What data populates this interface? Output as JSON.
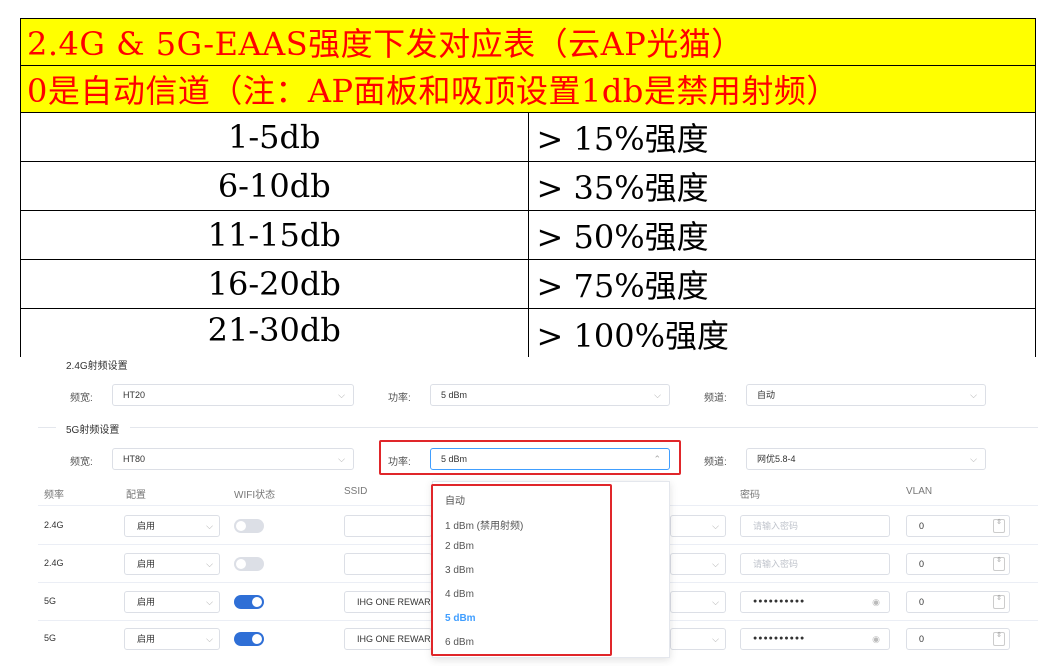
{
  "ref_table": {
    "title": "2.4G & 5G-EAAS强度下发对应表（云AP光猫）",
    "note": "0是自动信道（注：AP面板和吸顶设置1db是禁用射频）",
    "rows": [
      {
        "range": "1-5db",
        "value": "> 15%强度"
      },
      {
        "range": "6-10db",
        "value": "> 35%强度"
      },
      {
        "range": "11-15db",
        "value": "> 50%强度"
      },
      {
        "range": "16-20db",
        "value": "> 75%强度"
      },
      {
        "range": "21-30db",
        "value": "> 100%强度"
      }
    ]
  },
  "colors": {
    "highlight": "#ffff00",
    "red_text": "#ff0000",
    "accent": "#409eff",
    "toggle_on": "#2f6fd6",
    "red_box": "#e0262a"
  },
  "radio_24": {
    "section_title": "2.4G射频设置",
    "bandwidth_label": "频宽:",
    "bandwidth_value": "HT20",
    "power_label": "功率:",
    "power_value": "5 dBm",
    "channel_label": "频道:",
    "channel_value": "自动"
  },
  "radio_5": {
    "section_title": "5G射频设置",
    "bandwidth_label": "频宽:",
    "bandwidth_value": "HT80",
    "power_label": "功率:",
    "power_value": "5 dBm",
    "channel_label": "频道:",
    "channel_value": "网优5.8-4"
  },
  "wifi_table": {
    "headers": [
      "频率",
      "配置",
      "WIFI状态",
      "SSID",
      "密码",
      "VLAN"
    ],
    "rows": [
      {
        "freq": "2.4G",
        "config": "启用",
        "ssid": "",
        "password": "",
        "password_placeholder": "请输入密码",
        "vlan": "0"
      },
      {
        "freq": "2.4G",
        "config": "启用",
        "ssid": "",
        "password": "",
        "password_placeholder": "请输入密码",
        "vlan": "0"
      },
      {
        "freq": "5G",
        "config": "启用",
        "ssid": "IHG ONE REWAR",
        "password": "●●●●●●●●●●",
        "password_placeholder": "",
        "vlan": "0"
      },
      {
        "freq": "5G",
        "config": "启用",
        "ssid": "IHG ONE REWAR",
        "password": "●●●●●●●●●●",
        "password_placeholder": "",
        "vlan": "0"
      }
    ]
  },
  "power_dropdown": {
    "options": [
      "自动",
      "1 dBm (禁用射频)",
      "2 dBm",
      "3 dBm",
      "4 dBm",
      "5 dBm",
      "6 dBm"
    ],
    "selected": "5 dBm"
  },
  "icons": {
    "chevron_down": "⌵",
    "chevron_up": "⌃",
    "eye": "◉",
    "spin": "⇳"
  }
}
